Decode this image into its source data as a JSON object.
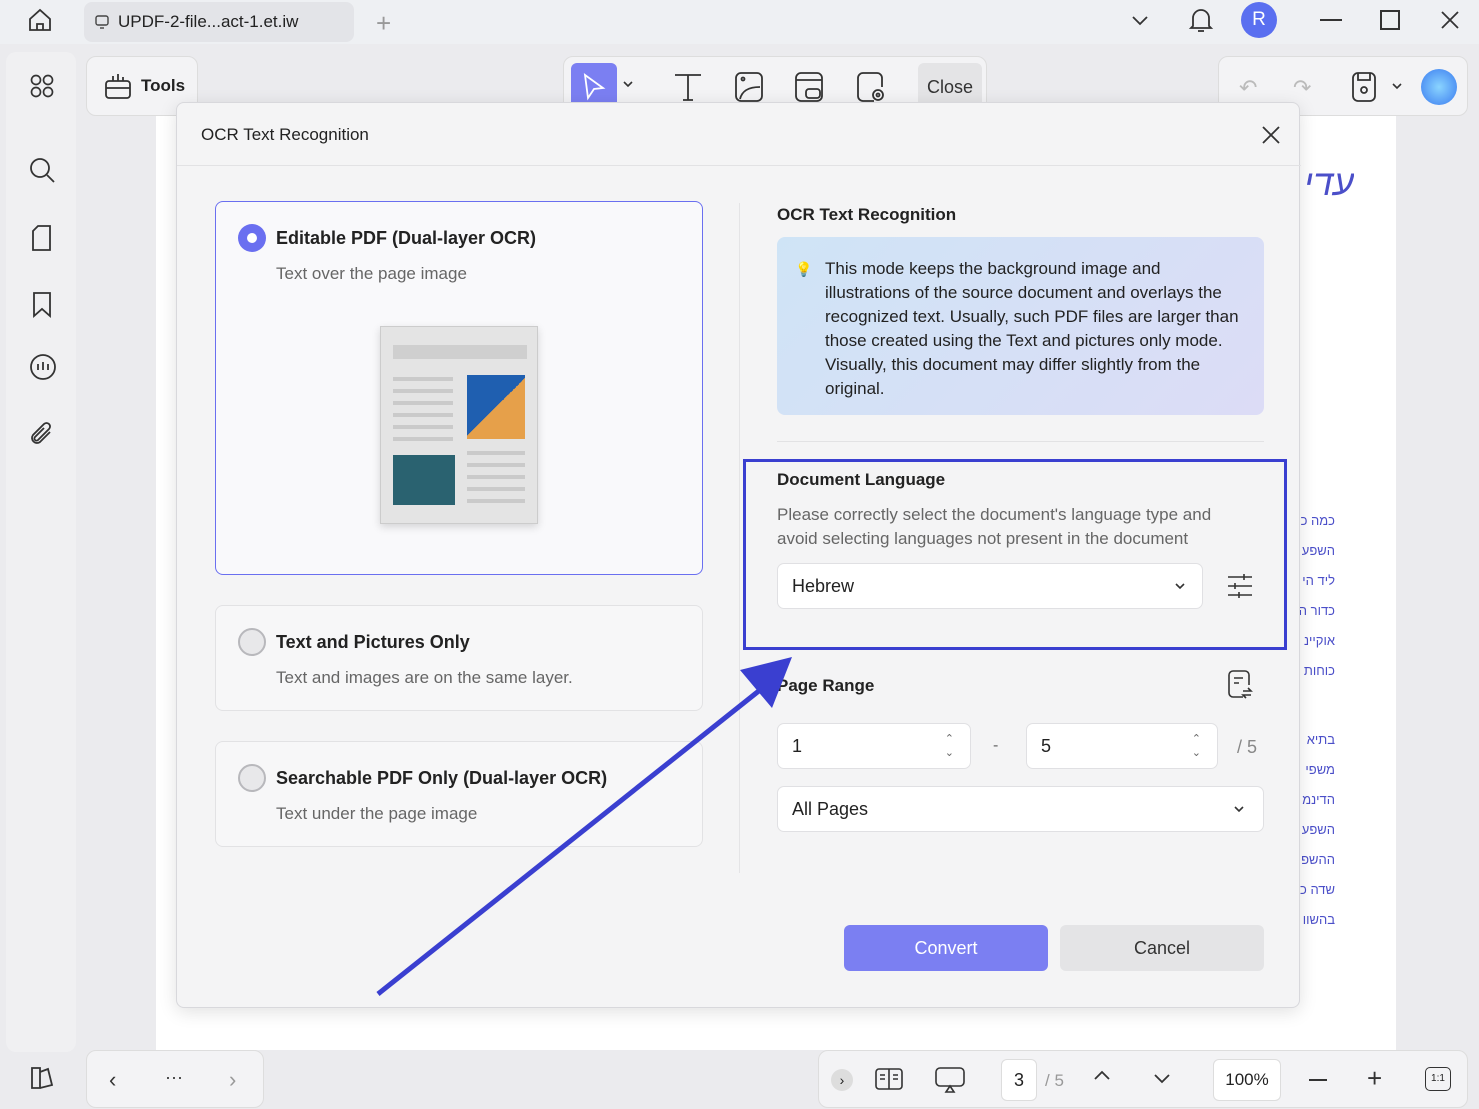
{
  "tab": {
    "title": "UPDF-2-file...act-1.et.iw"
  },
  "user": {
    "initial": "R"
  },
  "tools_label": "Tools",
  "toolbar": {
    "close_label": "Close"
  },
  "document": {
    "title_fragment": "עדי",
    "lines": [
      "כמה כ",
      "השפע",
      "ליד הי",
      "כדור ה",
      "אוקיינ",
      "כוחות",
      "בתיא",
      "משפי",
      "הדינמ",
      "השפע",
      "ההשפ",
      "שדה כ",
      "בהשוו"
    ]
  },
  "dialog": {
    "title": "OCR Text Recognition",
    "modes": [
      {
        "title": "Editable PDF (Dual-layer OCR)",
        "subtitle": "Text over the page image",
        "selected": true
      },
      {
        "title": "Text and Pictures Only",
        "subtitle": "Text and images are on the same layer.",
        "selected": false
      },
      {
        "title": "Searchable PDF Only (Dual-layer OCR)",
        "subtitle": "Text under the page image",
        "selected": false
      }
    ],
    "right_title": "OCR Text Recognition",
    "info_text": "This mode keeps the background image and illustrations of the source document and overlays the recognized text. Usually, such PDF files are larger than those created using the Text and pictures only mode. Visually, this document may differ slightly from the original.",
    "language": {
      "label": "Document Language",
      "hint": "Please correctly select the document's language type and avoid selecting languages not present in the document",
      "value": "Hebrew"
    },
    "page_range": {
      "label": "Page Range",
      "from": "1",
      "to": "5",
      "dash": "-",
      "total": "/ 5",
      "preset": "All Pages"
    },
    "convert_label": "Convert",
    "cancel_label": "Cancel"
  },
  "bottom": {
    "page": "3",
    "total": "/ 5",
    "zoom": "100%",
    "fit_label": "1:1",
    "more": "···"
  },
  "colors": {
    "accent": "#6a6ff0",
    "highlight": "#3a3fd0"
  }
}
